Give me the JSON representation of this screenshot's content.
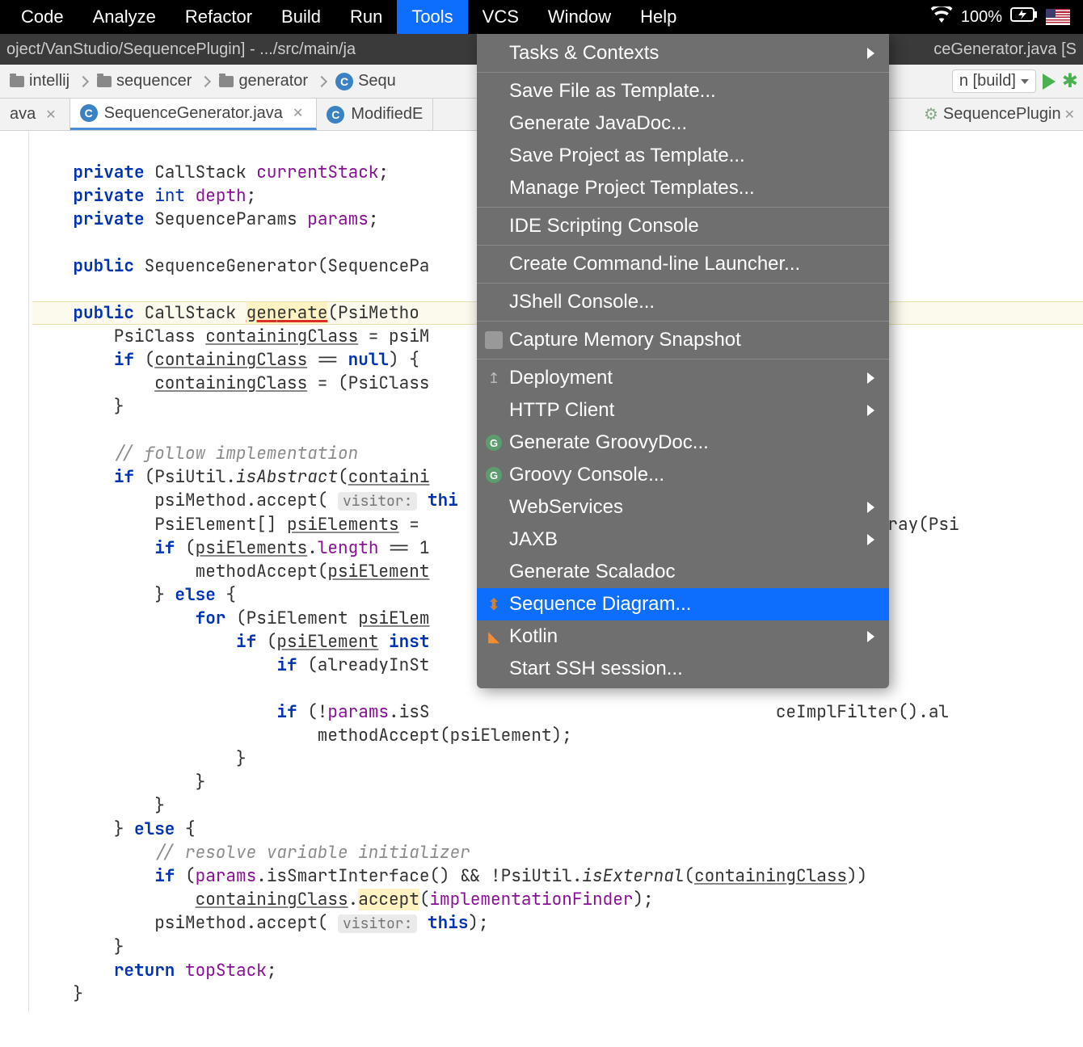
{
  "menubar": {
    "items": [
      "Code",
      "Analyze",
      "Refactor",
      "Build",
      "Run",
      "Tools",
      "VCS",
      "Window",
      "Help"
    ],
    "active": "Tools",
    "battery": "100%"
  },
  "titlebar": {
    "left": "oject/VanStudio/SequencePlugin] - .../src/main/ja",
    "right": "ceGenerator.java [S"
  },
  "breadcrumbs": {
    "items": [
      "intellij",
      "sequencer",
      "generator",
      "Sequ"
    ],
    "last_is_class": true
  },
  "run_config": {
    "label": "n [build]"
  },
  "tabs": {
    "left_partial": "ava",
    "items": [
      {
        "label": "SequenceGenerator.java",
        "icon": "C",
        "active": true
      },
      {
        "label": "ModifiedE",
        "icon": "C",
        "active": false
      }
    ],
    "right_partial": {
      "label": "SequencePlugin"
    }
  },
  "tools_menu": [
    {
      "label": "Tasks & Contexts",
      "submenu": true
    },
    {
      "sep": true
    },
    {
      "label": "Save File as Template..."
    },
    {
      "label": "Generate JavaDoc..."
    },
    {
      "label": "Save Project as Template..."
    },
    {
      "label": "Manage Project Templates..."
    },
    {
      "sep": true
    },
    {
      "label": "IDE Scripting Console"
    },
    {
      "sep": true
    },
    {
      "label": "Create Command-line Launcher..."
    },
    {
      "sep": true
    },
    {
      "label": "JShell Console..."
    },
    {
      "sep": true
    },
    {
      "label": "Capture Memory Snapshot",
      "icon": "cam"
    },
    {
      "sep": true
    },
    {
      "label": "Deployment",
      "submenu": true,
      "icon": "up"
    },
    {
      "label": "HTTP Client",
      "submenu": true
    },
    {
      "label": "Generate GroovyDoc...",
      "icon": "g"
    },
    {
      "label": "Groovy Console...",
      "icon": "g"
    },
    {
      "label": "WebServices",
      "submenu": true
    },
    {
      "label": "JAXB",
      "submenu": true
    },
    {
      "label": "Generate Scaladoc"
    },
    {
      "label": "Sequence Diagram...",
      "icon": "seq",
      "highlight": true
    },
    {
      "label": "Kotlin",
      "submenu": true,
      "icon": "k"
    },
    {
      "label": "Start SSH session..."
    }
  ],
  "code": {
    "l1": "    private CallStack currentStack;",
    "l2": "    private int depth;",
    "l3": "    private SequenceParams params;",
    "l4": "",
    "l5": "    public SequenceGenerator(SequencePa                                      }",
    "l6": "",
    "l7": "    public CallStack generate(PsiMetho",
    "l8": "        PsiClass containingClass = psiM",
    "l9": "        if (containingClass == null) {",
    "l10": "            containingClass = (PsiClass                                     ;",
    "l11": "        }",
    "l12": "",
    "l13": "        // follow implementation",
    "l14": "        if (PsiUtil.isAbstract(containi",
    "l15": "            psiMethod.accept( visitor: thi",
    "l16": "            PsiElement[] psiElements =                                    thod).toArray(Psi",
    "l17": "            if (psiElements.length == 1",
    "l18": "                methodAccept(psiElement",
    "l19": "            } else {",
    "l20": "                for (PsiElement psiElem",
    "l21": "                    if (psiElement inst",
    "l22": "                        if (alreadyInSt                                  e;",
    "l23": "",
    "l24": "                        if (!params.isS                                  ceImplFilter().al",
    "l25": "                            methodAccept(psiElement);",
    "l26": "                    }",
    "l27": "                }",
    "l28": "            }",
    "l29": "        } else {",
    "l30": "            // resolve variable initializer",
    "l31": "            if (params.isSmartInterface() && !PsiUtil.isExternal(containingClass))",
    "l32": "                containingClass.accept(implementationFinder);",
    "l33": "            psiMethod.accept( visitor: this);",
    "l34": "        }",
    "l35": "        return topStack;",
    "l36": "    }"
  }
}
